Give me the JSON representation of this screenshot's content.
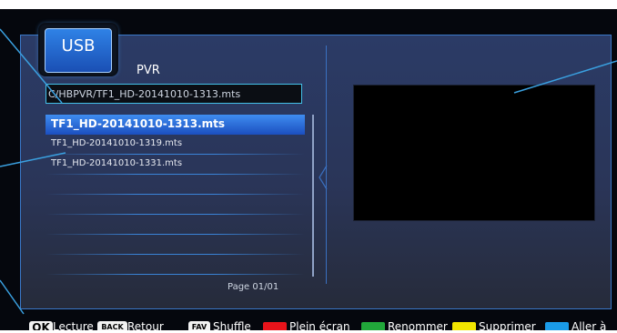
{
  "header": {
    "usb_label": "USB",
    "title": "PVR"
  },
  "path": "C/HBPVR/TF1_HD-20141010-1313.mts",
  "files": [
    {
      "name": "TF1_HD-20141010-1313.mts",
      "selected": true
    },
    {
      "name": "TF1_HD-20141010-1319.mts",
      "selected": false
    },
    {
      "name": "TF1_HD-20141010-1331.mts",
      "selected": false
    },
    {
      "name": "",
      "selected": false
    },
    {
      "name": "",
      "selected": false
    },
    {
      "name": "",
      "selected": false
    },
    {
      "name": "",
      "selected": false
    },
    {
      "name": "",
      "selected": false
    }
  ],
  "page_indicator": "Page  01/01",
  "footer": {
    "ok_key": "OK",
    "ok_label": "Lecture",
    "back_key": "BACK",
    "back_label": "Retour",
    "fav_key": "FAV",
    "fav_label": "Shuffle",
    "red_label": "Plein écran",
    "green_label": "Renommer",
    "yellow_label": "Supprimer",
    "blue_label": "Aller à"
  },
  "colors": {
    "red": "#e8131a",
    "green": "#21a83a",
    "yellow": "#f2e600",
    "blue": "#1a9be8",
    "accent": "#3a8bf0",
    "callout": "#3aa0e0"
  }
}
